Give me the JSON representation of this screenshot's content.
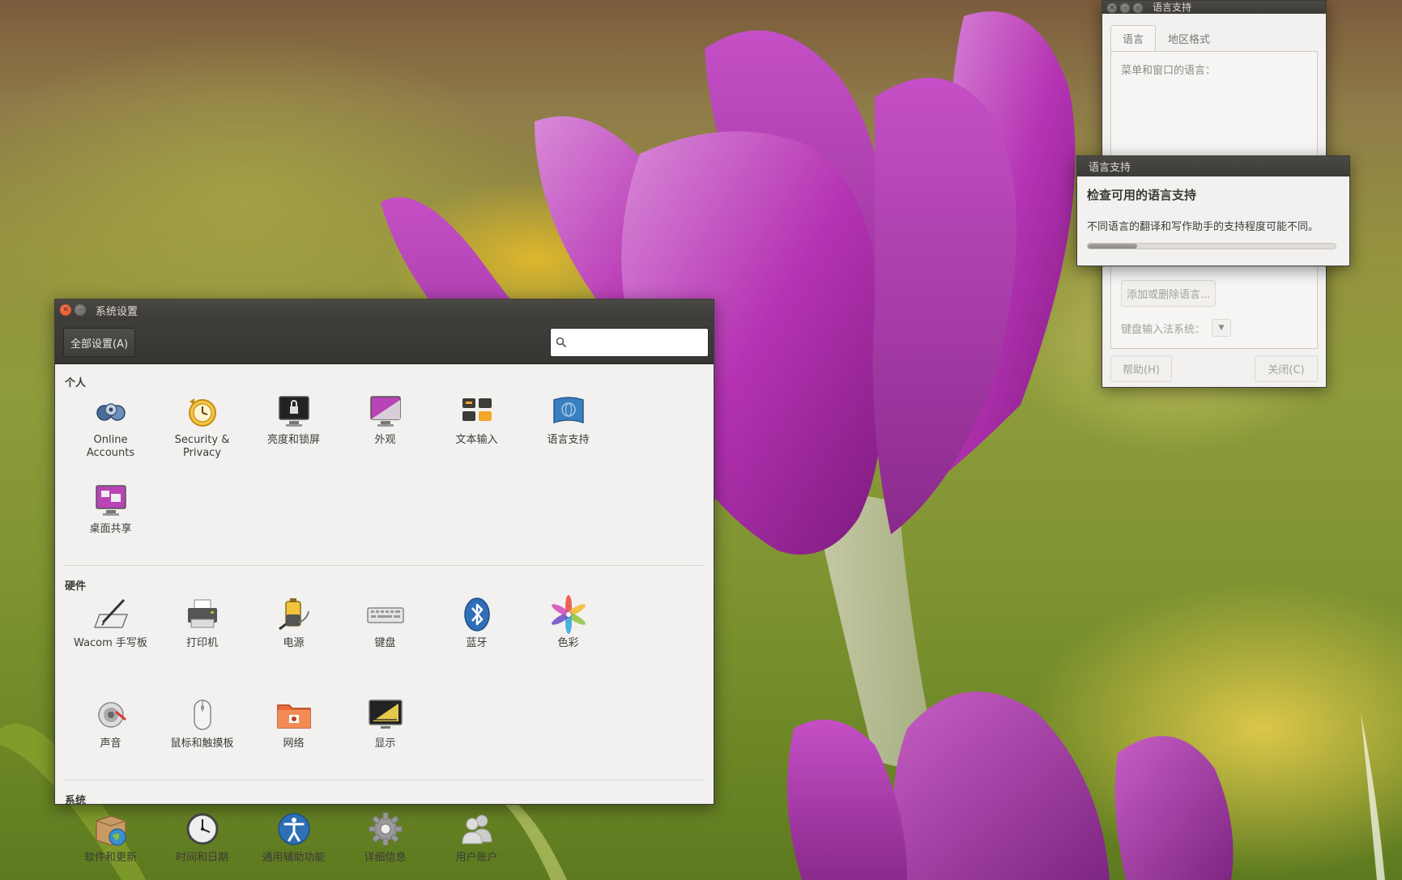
{
  "settings_window": {
    "title": "系统设置",
    "all_settings_label": "全部设置(A)",
    "search_placeholder": "",
    "sections": {
      "personal": {
        "title": "个人",
        "items": [
          {
            "label": "Online Accounts",
            "icon": "online-accounts-icon"
          },
          {
            "label": "Security & Privacy",
            "icon": "security-privacy-icon"
          },
          {
            "label": "亮度和锁屏",
            "icon": "brightness-lock-icon"
          },
          {
            "label": "外观",
            "icon": "appearance-icon"
          },
          {
            "label": "文本输入",
            "icon": "text-entry-icon"
          },
          {
            "label": "语言支持",
            "icon": "language-support-icon"
          },
          {
            "label": "桌面共享",
            "icon": "desktop-sharing-icon"
          }
        ]
      },
      "hardware": {
        "title": "硬件",
        "items": [
          {
            "label": "Wacom 手写板",
            "icon": "wacom-tablet-icon"
          },
          {
            "label": "打印机",
            "icon": "printer-icon"
          },
          {
            "label": "电源",
            "icon": "power-icon"
          },
          {
            "label": "键盘",
            "icon": "keyboard-icon"
          },
          {
            "label": "蓝牙",
            "icon": "bluetooth-icon"
          },
          {
            "label": "色彩",
            "icon": "color-icon"
          },
          {
            "label": "声音",
            "icon": "sound-icon"
          },
          {
            "label": "鼠标和触摸板",
            "icon": "mouse-touchpad-icon"
          },
          {
            "label": "网络",
            "icon": "network-icon"
          },
          {
            "label": "显示",
            "icon": "display-icon"
          }
        ]
      },
      "system": {
        "title": "系统",
        "items": [
          {
            "label": "软件和更新",
            "icon": "software-updates-icon"
          },
          {
            "label": "时间和日期",
            "icon": "time-date-icon"
          },
          {
            "label": "通用辅助功能",
            "icon": "universal-access-icon"
          },
          {
            "label": "详细信息",
            "icon": "details-icon"
          },
          {
            "label": "用户账户",
            "icon": "user-accounts-icon"
          }
        ]
      }
    }
  },
  "language_window": {
    "title": "语言支持",
    "tabs": [
      "语言",
      "地区格式"
    ],
    "menu_language_label": "菜单和窗口的语言：",
    "add_remove_label": "添加或删除语言...",
    "keyboard_input_label": "键盘输入法系统：",
    "help_label": "帮助(H)",
    "close_label": "关闭(C)"
  },
  "progress_dialog": {
    "title": "语言支持",
    "heading": "检查可用的语言支持",
    "text": "不同语言的翻译和写作助手的支持程度可能不同。",
    "progress": 0.2
  },
  "colors": {
    "titlebar": "#3c3b37",
    "window_bg": "#f2f1f0",
    "close_button": "#df4a16"
  }
}
